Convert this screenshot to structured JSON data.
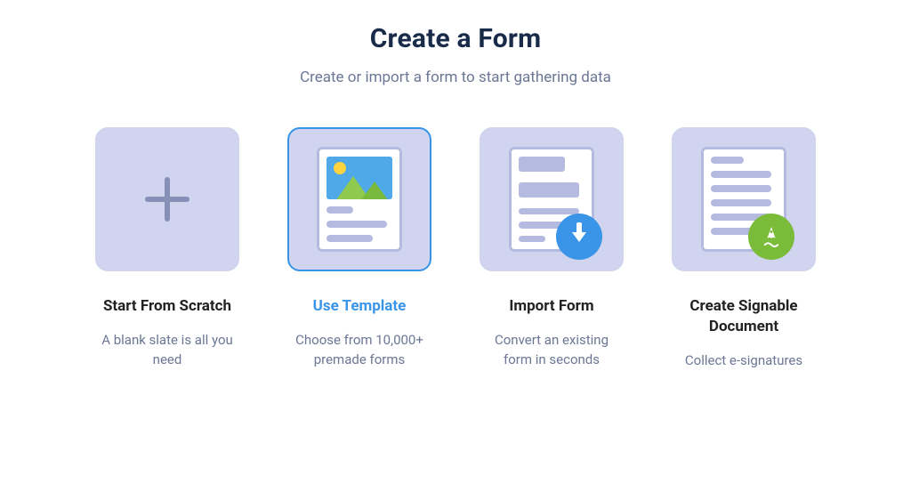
{
  "header": {
    "title": "Create a Form",
    "subtitle": "Create or import a form to start gathering data"
  },
  "options": [
    {
      "title": "Start From Scratch",
      "description": "A blank slate is all you need"
    },
    {
      "title": "Use Template",
      "description": "Choose from 10,000+ premade forms"
    },
    {
      "title": "Import Form",
      "description": "Convert an existing form in seconds"
    },
    {
      "title": "Create Signable Document",
      "description": "Collect e-signatures"
    }
  ]
}
